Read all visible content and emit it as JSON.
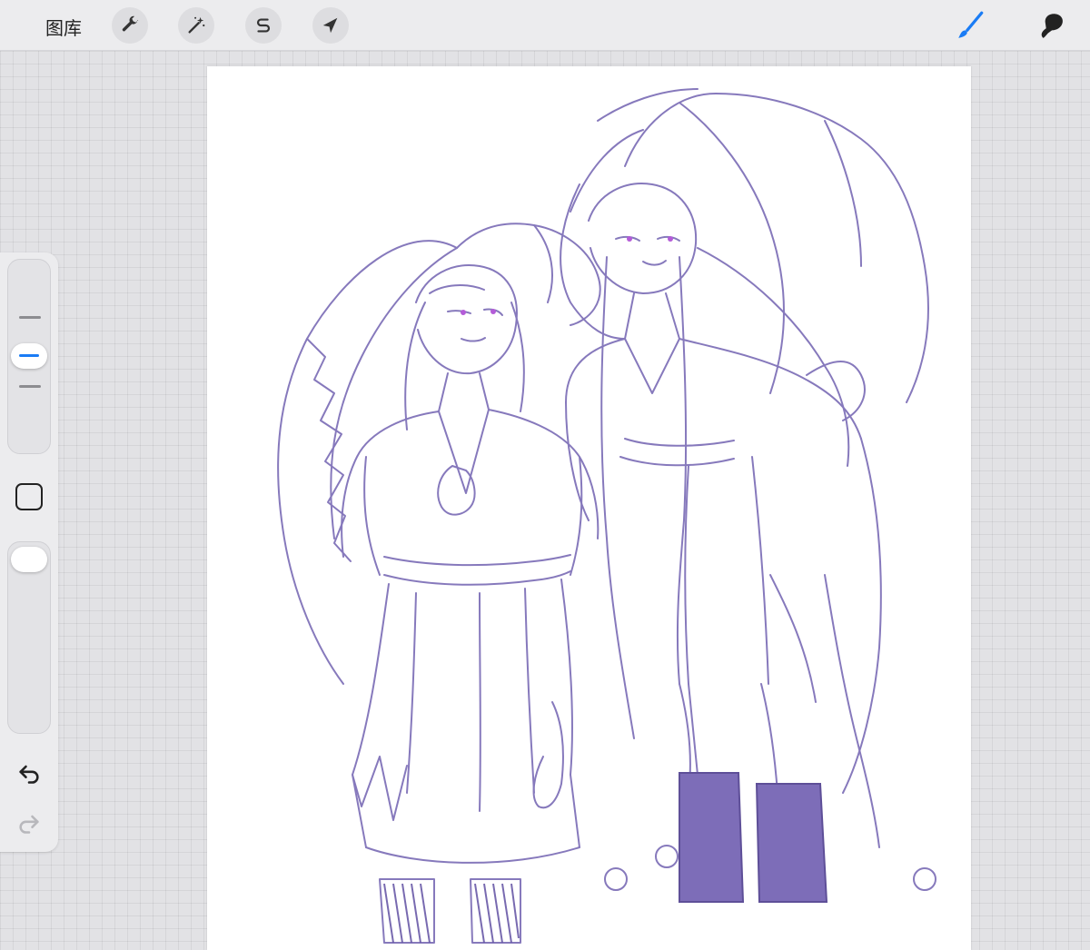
{
  "toolbar": {
    "gallery_label": "图库",
    "left_tools": [
      {
        "icon": "wrench-icon",
        "name": "actions"
      },
      {
        "icon": "magic-wand-icon",
        "name": "adjustments"
      },
      {
        "icon": "selection-s-icon",
        "name": "selection"
      },
      {
        "icon": "arrow-cursor-icon",
        "name": "transform"
      }
    ],
    "right_tools": [
      {
        "icon": "brush-icon",
        "name": "paint",
        "active": true
      },
      {
        "icon": "smudge-icon",
        "name": "smudge",
        "active": false
      }
    ]
  },
  "sidebar": {
    "brush_size_icon": "size-slider",
    "modify_icon": "square-modify-icon",
    "opacity_icon": "opacity-slider",
    "undo_icon": "undo-arrow-icon",
    "redo_icon": "redo-arrow-icon",
    "brush_size_level": 0.55,
    "opacity_level": 1.0
  },
  "canvas": {
    "content": "sketch-illustration",
    "ink_color": "#7a6bb5"
  },
  "colors": {
    "accent": "#1a7cf5",
    "toolbar_bg": "#ececee",
    "workspace_bg": "#e2e2e5",
    "canvas_bg": "#ffffff"
  }
}
